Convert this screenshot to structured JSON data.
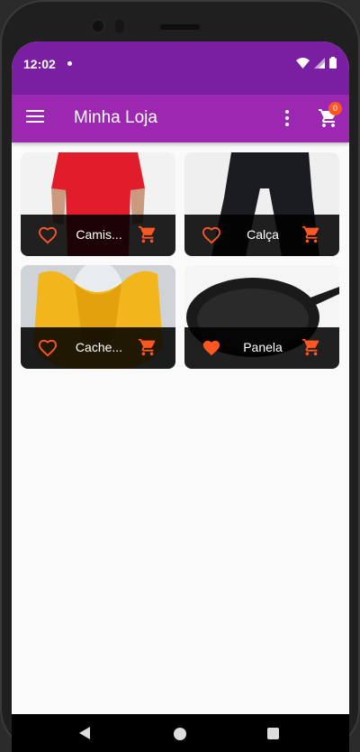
{
  "status_bar": {
    "time": "12:02"
  },
  "app_bar": {
    "title": "Minha Loja",
    "cart_count": "0"
  },
  "products": [
    {
      "name": "Camis...",
      "favorite": false,
      "image": "red-tshirt"
    },
    {
      "name": "Calça",
      "favorite": false,
      "image": "black-pants"
    },
    {
      "name": "Cache...",
      "favorite": false,
      "image": "yellow-scarf"
    },
    {
      "name": "Panela",
      "favorite": true,
      "image": "frying-pan"
    }
  ],
  "colors": {
    "status_bar": "#7b1fa2",
    "app_bar": "#9c27b0",
    "accent": "#ff5722",
    "card_footer": "#000000"
  }
}
